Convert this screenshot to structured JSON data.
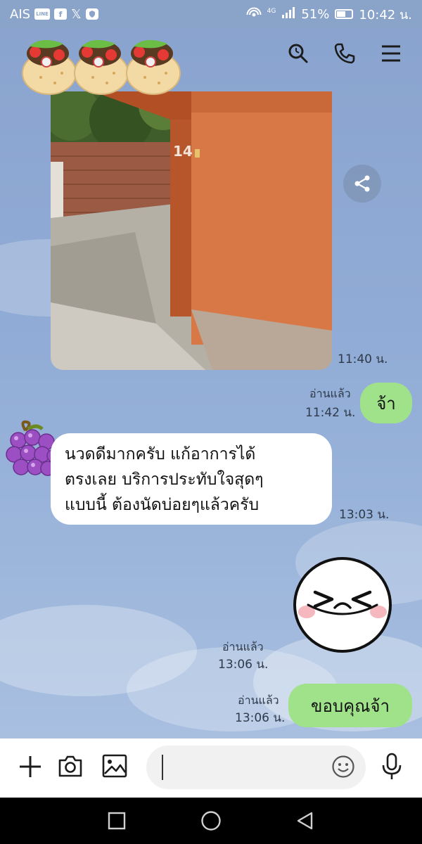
{
  "status_bar": {
    "carrier": "AIS",
    "icon_1": "LINE",
    "icon_2": "f",
    "icon_3": "𝕏",
    "battery_percent": "51%",
    "clock": "10:42 น.",
    "network": "4G"
  },
  "header": {
    "profile_sticker": "burrito-sticker",
    "icons": [
      "search-icon",
      "phone-icon",
      "menu-icon"
    ]
  },
  "messages": {
    "photo_time": "11:40 น.",
    "share_icon": "share-icon",
    "reply1": {
      "read": "อ่านแล้ว",
      "time": "11:42 น.",
      "text": "จ้า"
    },
    "incoming": {
      "avatar": "grapes-avatar",
      "lines": [
        "นวดดีมากครับ แก้อาการได้",
        "ตรงเลย บริการประทับใจสุดๆ",
        "แบบนี้  ต้องนัดบ่อยๆแล้วครับ"
      ],
      "time": "13:03 น."
    },
    "sticker": {
      "read": "อ่านแล้ว",
      "time": "13:06 น."
    },
    "reply2": {
      "read": "อ่านแล้ว",
      "time": "13:06 น.",
      "text": "ขอบคุณจ้า"
    }
  },
  "input_bar": {
    "icons": [
      "plus-icon",
      "camera-icon",
      "image-icon",
      "emoji-icon",
      "mic-icon"
    ],
    "value": ""
  },
  "nav_bar": {
    "icons": [
      "recents-icon",
      "home-icon",
      "back-icon"
    ]
  },
  "colors": {
    "chat_bg": "#8da7cf",
    "green_bubble": "#9fe28a",
    "white_bubble": "#ffffff"
  }
}
